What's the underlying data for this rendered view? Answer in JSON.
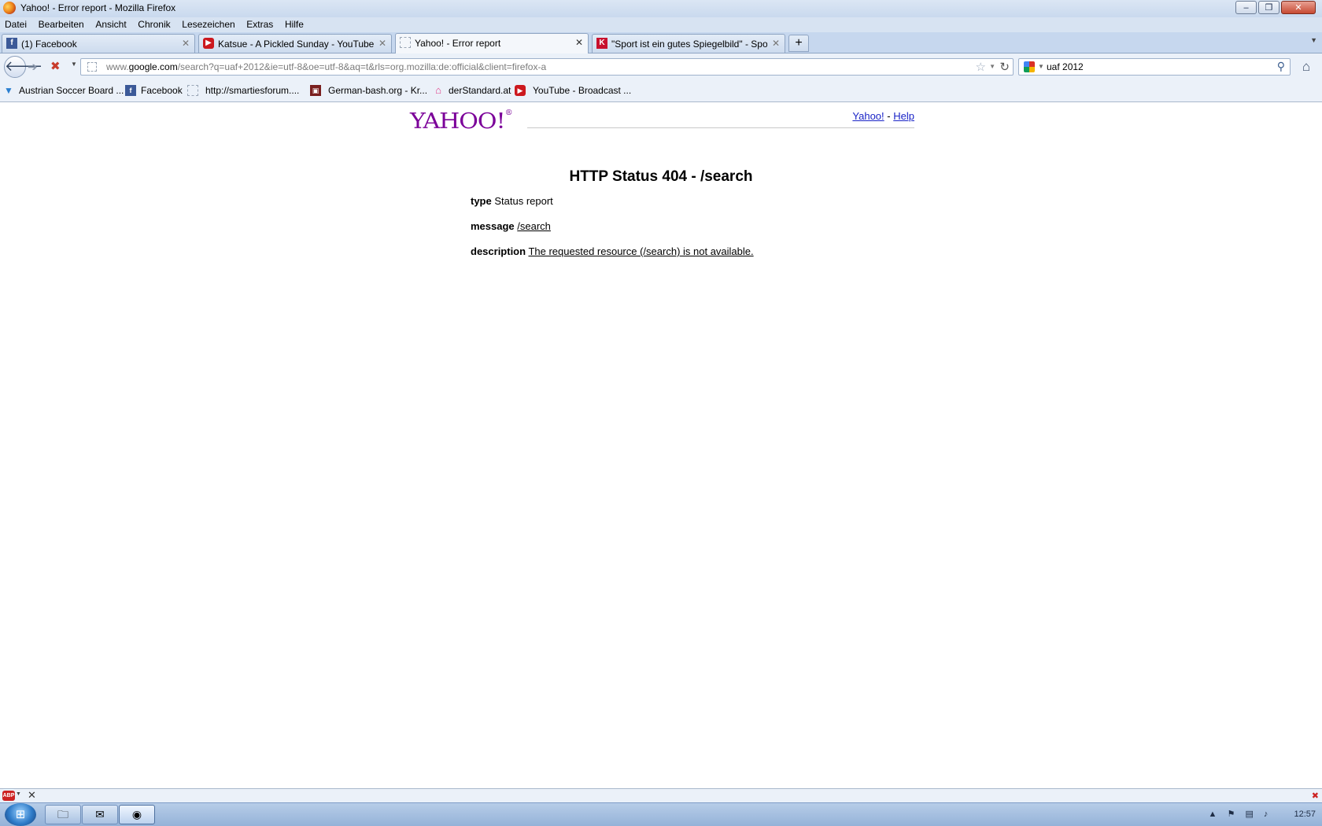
{
  "window": {
    "title": "Yahoo! - Error report - Mozilla Firefox",
    "controls": {
      "minimize": "‒",
      "maximize": "❐",
      "close": "✕"
    }
  },
  "menu": [
    "Datei",
    "Bearbeiten",
    "Ansicht",
    "Chronik",
    "Lesezeichen",
    "Extras",
    "Hilfe"
  ],
  "tabs": [
    {
      "label": "(1) Facebook",
      "icon": "facebook-icon",
      "active": false
    },
    {
      "label": "Katsue - A Pickled Sunday - YouTube",
      "icon": "youtube-icon",
      "active": false
    },
    {
      "label": "Yahoo! - Error report",
      "icon": "blank-page-icon",
      "active": true
    },
    {
      "label": "\"Sport ist ein gutes Spiegelbild\" - Spo...",
      "icon": "kurier-icon",
      "active": false
    }
  ],
  "tab_close_glyph": "✕",
  "new_tab_glyph": "+",
  "nav": {
    "url_host": "www.google.com",
    "url_prefix": "www.",
    "url_domain": "google.com",
    "url_path": "/search?q=uaf+2012&ie=utf-8&oe=utf-8&aq=t&rls=org.mozilla:de:official&client=firefox-a",
    "search_value": "uaf 2012",
    "search_engine_icon": "google-icon"
  },
  "bookmarks": [
    {
      "label": "Austrian Soccer Board ...",
      "icon": "asb-icon"
    },
    {
      "label": "Facebook",
      "icon": "facebook-icon"
    },
    {
      "label": "http://smartiesforum....",
      "icon": "blank-page-icon"
    },
    {
      "label": "German-bash.org - Kr...",
      "icon": "german-bash-icon"
    },
    {
      "label": "derStandard.at",
      "icon": "derstandard-icon"
    },
    {
      "label": "YouTube - Broadcast ...",
      "icon": "youtube-icon"
    }
  ],
  "page": {
    "logo_text": "YAHOO!",
    "logo_reg": "®",
    "links": {
      "yahoo": "Yahoo!",
      "separator": "-",
      "help": "Help"
    },
    "error_title": "HTTP Status 404 - /search",
    "rows": {
      "type_label": "type",
      "type_value": "Status report",
      "message_label": "message",
      "message_value": "/search",
      "description_label": "description",
      "description_value": "The requested resource (/search) is not available."
    }
  },
  "taskbar": {
    "clock": "12:57",
    "apps": [
      "explorer-icon",
      "thunderbird-icon",
      "firefox-icon"
    ]
  },
  "colors": {
    "yahoo_purple": "#7b0099",
    "link_blue": "#1a24c7",
    "chrome_blue": "#c6d7ee"
  }
}
